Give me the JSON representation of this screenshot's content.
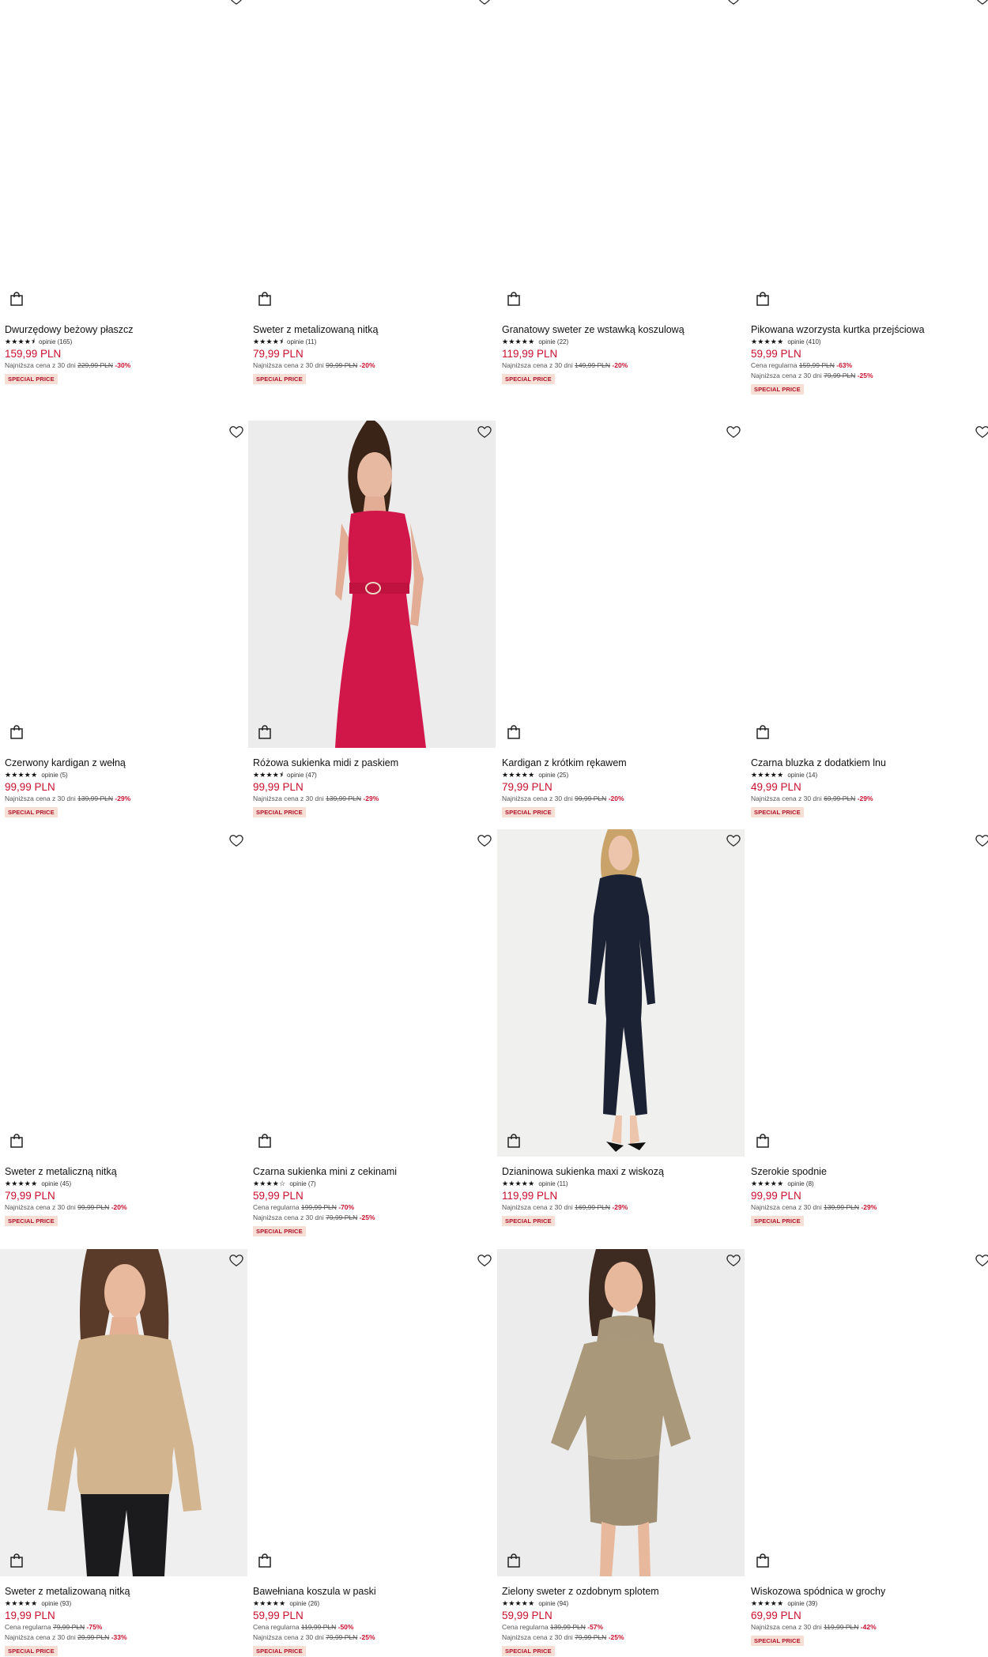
{
  "labels": {
    "badge": "SPECIAL PRICE",
    "lowest_prefix": "Najniższa cena z 30 dni",
    "regular_prefix": "Cena regularna"
  },
  "colors": {
    "price": "#c8102e",
    "badge_bg": "#f7dfd6",
    "badge_text": "#b01028"
  },
  "icons": {
    "favorite": "heart-outline-icon",
    "cart": "shopping-bag-icon"
  },
  "products": [
    {
      "name": "Dwurzędowy beżowy płaszcz",
      "rating": 4.5,
      "stars": "★★★★⯨",
      "reviews": "opinie (165)",
      "price": "159,99 PLN",
      "notes": [
        {
          "prefix": "Najniższa cena z 30 dni",
          "old": "229,99 PLN",
          "discount": "-30%"
        }
      ],
      "image": "none"
    },
    {
      "name": "Sweter z metalizowaną nitką",
      "rating": 4.5,
      "stars": "★★★★⯨",
      "reviews": "opinie (11)",
      "price": "79,99 PLN",
      "notes": [
        {
          "prefix": "Najniższa cena z 30 dni",
          "old": "99,99 PLN",
          "discount": "-20%"
        }
      ],
      "image": "none"
    },
    {
      "name": "Granatowy sweter ze wstawką koszulową",
      "rating": 5,
      "stars": "★★★★★",
      "reviews": "opinie (22)",
      "price": "119,99 PLN",
      "notes": [
        {
          "prefix": "Najniższa cena z 30 dni",
          "old": "149,99 PLN",
          "discount": "-20%"
        }
      ],
      "image": "none"
    },
    {
      "name": "Pikowana wzorzysta kurtka przejściowa",
      "rating": 5,
      "stars": "★★★★★",
      "reviews": "opinie (410)",
      "price": "59,99 PLN",
      "notes": [
        {
          "prefix": "Cena regularna",
          "old": "159,99 PLN",
          "discount": "-63%"
        },
        {
          "prefix": "Najniższa cena z 30 dni",
          "old": "79,99 PLN",
          "discount": "-25%"
        }
      ],
      "image": "none"
    },
    {
      "name": "Czerwony kardigan z wełną",
      "rating": 5,
      "stars": "★★★★★",
      "reviews": "opinie (5)",
      "price": "99,99 PLN",
      "notes": [
        {
          "prefix": "Najniższa cena z 30 dni",
          "old": "139,99 PLN",
          "discount": "-29%"
        }
      ],
      "image": "none"
    },
    {
      "name": "Różowa sukienka midi z paskiem",
      "rating": 4.5,
      "stars": "★★★★⯨",
      "reviews": "opinie (47)",
      "price": "99,99 PLN",
      "notes": [
        {
          "prefix": "Najniższa cena z 30 dni",
          "old": "139,99 PLN",
          "discount": "-29%"
        }
      ],
      "image": "red-dress"
    },
    {
      "name": "Kardigan z krótkim rękawem",
      "rating": 5,
      "stars": "★★★★★",
      "reviews": "opinie (25)",
      "price": "79,99 PLN",
      "notes": [
        {
          "prefix": "Najniższa cena z 30 dni",
          "old": "99,99 PLN",
          "discount": "-20%"
        }
      ],
      "image": "none"
    },
    {
      "name": "Czarna bluzka z dodatkiem lnu",
      "rating": 5,
      "stars": "★★★★★",
      "reviews": "opinie (14)",
      "price": "49,99 PLN",
      "notes": [
        {
          "prefix": "Najniższa cena z 30 dni",
          "old": "69,99 PLN",
          "discount": "-29%"
        }
      ],
      "image": "none"
    },
    {
      "name": "Sweter z metaliczną nitką",
      "rating": 5,
      "stars": "★★★★★",
      "reviews": "opinie (45)",
      "price": "79,99 PLN",
      "notes": [
        {
          "prefix": "Najniższa cena z 30 dni",
          "old": "99,99 PLN",
          "discount": "-20%"
        }
      ],
      "image": "none"
    },
    {
      "name": "Czarna sukienka mini z cekinami",
      "rating": 4,
      "stars": "★★★★☆",
      "reviews": "opinie (7)",
      "price": "59,99 PLN",
      "notes": [
        {
          "prefix": "Cena regularna",
          "old": "199,99 PLN",
          "discount": "-70%"
        },
        {
          "prefix": "Najniższa cena z 30 dni",
          "old": "79,99 PLN",
          "discount": "-25%"
        }
      ],
      "image": "none"
    },
    {
      "name": "Dzianinowa sukienka maxi z wiskozą",
      "rating": 5,
      "stars": "★★★★★",
      "reviews": "opinie (11)",
      "price": "119,99 PLN",
      "notes": [
        {
          "prefix": "Najniższa cena z 30 dni",
          "old": "169,99 PLN",
          "discount": "-29%"
        }
      ],
      "image": "navy-dress"
    },
    {
      "name": "Szerokie spodnie",
      "rating": 5,
      "stars": "★★★★★",
      "reviews": "opinie (8)",
      "price": "99,99 PLN",
      "notes": [
        {
          "prefix": "Najniższa cena z 30 dni",
          "old": "139,99 PLN",
          "discount": "-29%"
        }
      ],
      "image": "none"
    },
    {
      "name": "Sweter z metalizowaną nitką",
      "rating": 5,
      "stars": "★★★★★",
      "reviews": "opinie (93)",
      "price": "19,99 PLN",
      "notes": [
        {
          "prefix": "Cena regularna",
          "old": "79,99 PLN",
          "discount": "-75%"
        },
        {
          "prefix": "Najniższa cena z 30 dni",
          "old": "29,99 PLN",
          "discount": "-33%"
        }
      ],
      "image": "beige-sweater"
    },
    {
      "name": "Bawełniana koszula w paski",
      "rating": 5,
      "stars": "★★★★★",
      "reviews": "opinie (26)",
      "price": "59,99 PLN",
      "notes": [
        {
          "prefix": "Cena regularna",
          "old": "119,99 PLN",
          "discount": "-50%"
        },
        {
          "prefix": "Najniższa cena z 30 dni",
          "old": "79,99 PLN",
          "discount": "-25%"
        }
      ],
      "image": "none"
    },
    {
      "name": "Zielony sweter z ozdobnym splotem",
      "rating": 5,
      "stars": "★★★★★",
      "reviews": "opinie (94)",
      "price": "59,99 PLN",
      "notes": [
        {
          "prefix": "Cena regularna",
          "old": "139,99 PLN",
          "discount": "-57%"
        },
        {
          "prefix": "Najniższa cena z 30 dni",
          "old": "79,99 PLN",
          "discount": "-25%"
        }
      ],
      "image": "olive-set"
    },
    {
      "name": "Wiskozowa spódnica w grochy",
      "rating": 5,
      "stars": "★★★★★",
      "reviews": "opinie (39)",
      "price": "69,99 PLN",
      "notes": [
        {
          "prefix": "Najniższa cena z 30 dni",
          "old": "119,99 PLN",
          "discount": "-42%"
        }
      ],
      "image": "none"
    }
  ]
}
